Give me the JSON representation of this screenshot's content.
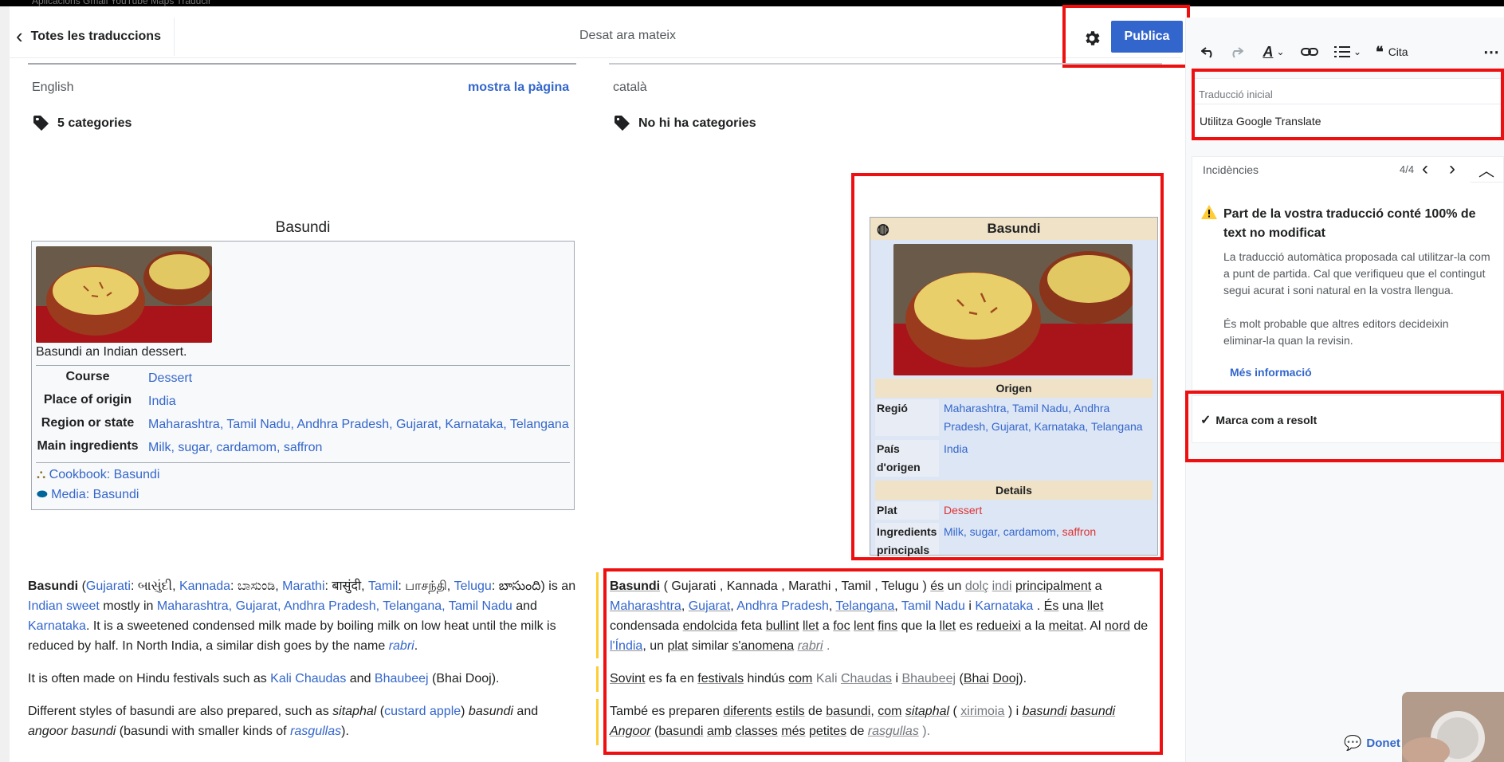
{
  "browser_bar": {
    "text": "Aplicacions   Gmail   YouTube   Maps   Traducir"
  },
  "header": {
    "back_label": "Totes les traduccions",
    "save_status": "Desat ara mateix",
    "publish_label": "Publica"
  },
  "source": {
    "language": "English",
    "show_page": "mostra la pàgina",
    "categories": "5 categories",
    "infobox": {
      "title": "Basundi",
      "caption": "Basundi an Indian dessert.",
      "rows": [
        {
          "label": "Course",
          "value": "Dessert"
        },
        {
          "label": "Place of origin",
          "value": "India"
        },
        {
          "label": "Region or state",
          "value": "Maharashtra, Tamil Nadu, Andhra Pradesh, Gujarat, Karnataka, Telangana"
        },
        {
          "label": "Main ingredients",
          "value": "Milk, sugar, cardamom, saffron"
        }
      ],
      "cookbook": "Cookbook: Basundi",
      "media": "Media: Basundi"
    },
    "paragraphs": {
      "p1": {
        "bold": "Basundi",
        "t1": " (",
        "gujarati_lbl": "Gujarati",
        "t2": ": બાસુંદી, ",
        "kannada_lbl": "Kannada",
        "t3": ": ಬಾಸುಂಡಿ, ",
        "marathi_lbl": "Marathi",
        "t4": ": बासुंदी, ",
        "tamil_lbl": "Tamil",
        "t5": ": பாசந்தி, ",
        "telugu_lbl": "Telugu",
        "t6": ": బాసుంది) is an ",
        "indian_sweet": "Indian sweet",
        "t7": " mostly in ",
        "states": "Maharashtra, Gujarat, Andhra Pradesh, Telangana, Tamil Nadu",
        "t8": " and ",
        "karnataka": "Karnataka",
        "t9": ". It is a sweetened condensed milk made by boiling milk on low heat until the milk is reduced by half. In North India, a similar dish goes by the name ",
        "rabri": "rabri",
        "t10": "."
      },
      "p2": {
        "t1": "It is often made on Hindu festivals such as ",
        "kali": "Kali Chaudas",
        "t2": " and ",
        "bhaubeej": "Bhaubeej",
        "t3": " (Bhai Dooj)."
      },
      "p3": {
        "t1": "Different styles of basundi are also prepared, such as ",
        "sitaphal": "sitaphal",
        "t2": " (",
        "custard": "custard apple",
        "t3": ") ",
        "basundi": "basundi",
        "t4": " and ",
        "angoor": "angoor basundi",
        "t5": " (basundi with smaller kinds of ",
        "rasgullas": "rasgullas",
        "t6": ")."
      }
    }
  },
  "target": {
    "language": "català",
    "categories": "No hi ha categories",
    "infobox": {
      "title": "Basundi",
      "section_origin": "Origen",
      "region_label": "Regió",
      "region_value": "Maharashtra, Tamil Nadu, Andhra Pradesh, Gujarat, Karnataka, Telangana",
      "country_label": "País d'origen",
      "country_value": "India",
      "section_details": "Details",
      "dish_label": "Plat",
      "dish_value": "Dessert",
      "ingredients_label": "Ingredients principals",
      "ingredients_value_a": "Milk, sugar, cardamom, ",
      "ingredients_value_b": "saffron"
    },
    "paragraphs": {
      "p1": {
        "bold": "Basundi",
        "t1": " ( Gujarati   , Kannada   , Marathi   , Tamil   , Telugu   ) ",
        "es": "és",
        "t2": " un ",
        "dolc": "dolç",
        "t3": " ",
        "indi": "indi",
        "t4": " ",
        "principalment": "principalment",
        "t5": " a ",
        "maharashtra": "Maharashtra",
        "t6": ", ",
        "gujarat": "Gujarat",
        "t7": ", ",
        "andhra": "Andhra Pradesh",
        "t8": ", ",
        "telangana": "Telangana",
        "t9": ", ",
        "tamilnadu": "Tamil Nadu",
        "t10": " i ",
        "karnataka": "Karnataka",
        "t11": " . ",
        "es2": "És",
        "t12": " una ",
        "llet": "llet",
        "t13": " condensada ",
        "endolcida": "endolcida",
        "t14": " feta ",
        "bullint": "bullint",
        "t15": " ",
        "llet2": "llet",
        "t16": " a ",
        "foc": "foc",
        "t17": " ",
        "lent": "lent",
        "t18": " ",
        "fins": "fins",
        "t19": " que la ",
        "llet3": "llet",
        "t20": " es ",
        "redueixi": "redueixi",
        "t21": " a la ",
        "meitat": "meitat",
        "t22": ". Al ",
        "nord": "nord",
        "t23": " de ",
        "india": "l'Índia",
        "t24": ", un ",
        "plat": "plat",
        "t25": " similar ",
        "anomena": "s'anomena",
        "t26": " ",
        "rabri": "rabri",
        "t27": " ."
      },
      "p2": {
        "sovint": "Sovint",
        "t1": " es fa en ",
        "festivals": "festivals",
        "t2": " hindús ",
        "com": "com",
        "t3": " Kali ",
        "chaudas": "Chaudas",
        "t4": " i ",
        "bhaubeej": "Bhaubeej",
        "t5": " (",
        "bhai": "Bhai",
        "t6": " ",
        "dooj": "Dooj",
        "t7": ")."
      },
      "p3": {
        "t1": "També es preparen ",
        "diferents": "diferents",
        "t2": " ",
        "estils": "estils",
        "t3": " de ",
        "basundi": "basundi",
        "t4": ", ",
        "com": "com",
        "t5": " ",
        "sitaphal": "sitaphal",
        "t6": " ( ",
        "xirimoia": "xirimoia",
        "t7": " ) i ",
        "basundi2": "basundi",
        "t8": " ",
        "basundi3": "basundi",
        "t9": " ",
        "angoor": "Angoor",
        "t10": " (",
        "basundi4": "basundi",
        "t11": " ",
        "amb": "amb",
        "t12": " ",
        "classes": "classes",
        "t13": " ",
        "mes": "més",
        "t14": " ",
        "petites": "petites",
        "t15": " de ",
        "rasgullas": "rasgullas",
        "t16": " )."
      }
    }
  },
  "sidebar": {
    "toolbar": {
      "cite_label": "Cita"
    },
    "mt": {
      "label": "Traducció inicial",
      "value": "Utilitza Google Translate"
    },
    "issues": {
      "label": "Incidències",
      "counter": "4/4",
      "title": "Part de la vostra traducció conté 100% de text no modificat",
      "body1": "La traducció automàtica proposada cal utilitzar-la com a punt de partida. Cal que verifiqueu que el contingut segui acurat i soni natural en la vostra llengua.",
      "body2": "És molt probable que altres editors decideixin eliminar-la quan la revisin.",
      "more": "Més informació",
      "resolve": "Marca com a resolt"
    },
    "donate": "Donet"
  },
  "colors": {
    "accent": "#3366cc",
    "highlight": "#ee1010",
    "warning": "#fc3",
    "redlink": "#d33"
  }
}
